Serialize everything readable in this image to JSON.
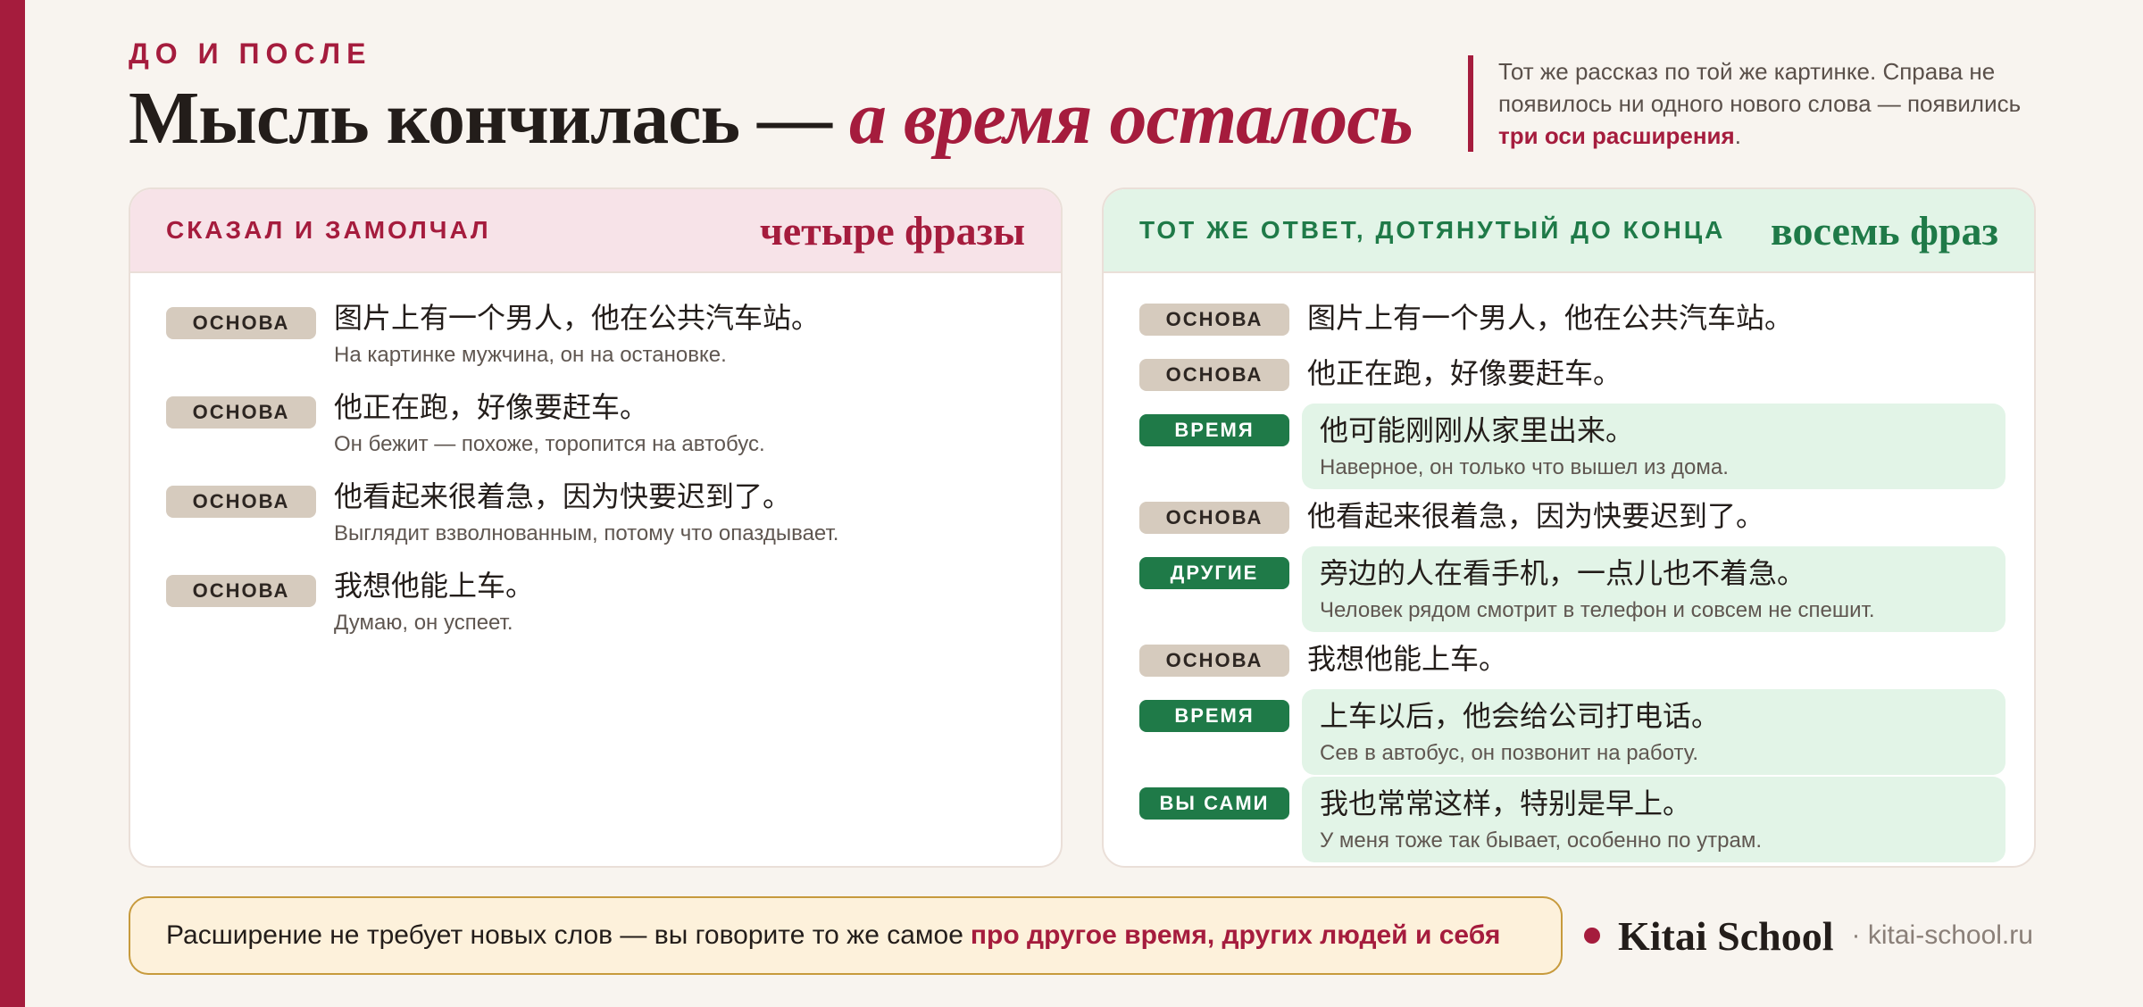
{
  "header": {
    "eyebrow": "До и после",
    "title_main": "Мысль кончилась —",
    "title_accent": "а время осталось",
    "intro_text": "Тот же рассказ по той же картинке. Справа не появилось ни одного нового слова — появились",
    "intro_highlight": "три оси расширения",
    "intro_end": "."
  },
  "left_panel": {
    "label": "Сказал и замолчал",
    "count": "четыре фразы",
    "rows": [
      {
        "tag": "Основа",
        "zh": "图片上有一个男人，他在公共汽车站。",
        "ru": "На картинке мужчина, он на остановке."
      },
      {
        "tag": "Основа",
        "zh": "他正在跑，好像要赶车。",
        "ru": "Он бежит — похоже, торопится на автобус."
      },
      {
        "tag": "Основа",
        "zh": "他看起来很着急，因为快要迟到了。",
        "ru": "Выглядит взволнованным, потому что опаздывает."
      },
      {
        "tag": "Основа",
        "zh": "我想他能上车。",
        "ru": "Думаю, он успеет."
      }
    ]
  },
  "right_panel": {
    "label": "Тот же ответ, дотянутый до конца",
    "count": "восемь фраз",
    "rows": [
      {
        "tag": "Основа",
        "zh": "图片上有一个男人，他在公共汽车站。"
      },
      {
        "tag": "Основа",
        "zh": "他正在跑，好像要赶车。"
      },
      {
        "tag": "Время",
        "zh": "他可能刚刚从家里出来。",
        "ru": "Наверное, он только что вышел из дома."
      },
      {
        "tag": "Основа",
        "zh": "他看起来很着急，因为快要迟到了。"
      },
      {
        "tag": "Другие",
        "zh": "旁边的人在看手机，一点儿也不着急。",
        "ru": "Человек рядом смотрит в телефон и совсем не спешит."
      },
      {
        "tag": "Основа",
        "zh": "我想他能上车。"
      },
      {
        "tag": "Время",
        "zh": "上车以后，他会给公司打电话。",
        "ru": "Сев в автобус, он позвонит на работу."
      },
      {
        "tag": "Вы сами",
        "zh": "我也常常这样，特别是早上。",
        "ru": "У меня тоже так бывает, особенно по утрам."
      }
    ]
  },
  "footer": {
    "text": "Расширение не требует новых слов — вы говорите то же самое",
    "highlight": "про другое время, других людей и себя",
    "brand_name": "Kitai School",
    "brand_url": "· kitai-school.ru"
  },
  "colors": {
    "accent": "#a51c3d",
    "green": "#1f7a48",
    "background": "#f8f4ef"
  }
}
